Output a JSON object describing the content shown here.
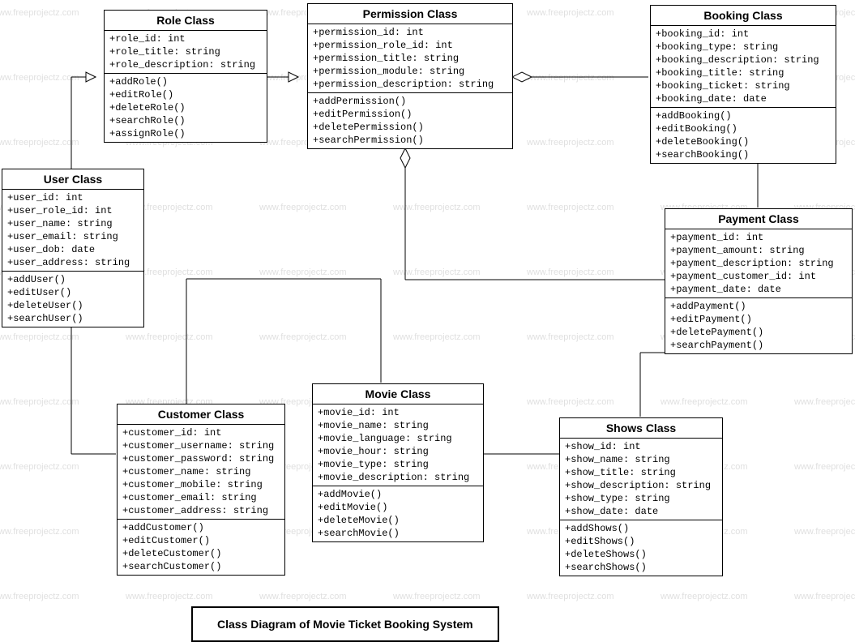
{
  "watermark_text": "www.freeprojectz.com",
  "caption": "Class Diagram of Movie Ticket Booking System",
  "classes": {
    "role": {
      "title": "Role Class",
      "attributes": [
        "+role_id: int",
        "+role_title: string",
        "+role_description: string"
      ],
      "operations": [
        "+addRole()",
        "+editRole()",
        "+deleteRole()",
        "+searchRole()",
        "+assignRole()"
      ]
    },
    "permission": {
      "title": "Permission Class",
      "attributes": [
        "+permission_id: int",
        "+permission_role_id: int",
        "+permission_title: string",
        "+permission_module: string",
        "+permission_description: string"
      ],
      "operations": [
        "+addPermission()",
        "+editPermission()",
        "+deletePermission()",
        "+searchPermission()"
      ]
    },
    "booking": {
      "title": "Booking Class",
      "attributes": [
        "+booking_id: int",
        "+booking_type: string",
        "+booking_description: string",
        "+booking_title: string",
        "+booking_ticket: string",
        "+booking_date: date"
      ],
      "operations": [
        "+addBooking()",
        "+editBooking()",
        "+deleteBooking()",
        "+searchBooking()"
      ]
    },
    "user": {
      "title": "User Class",
      "attributes": [
        "+user_id: int",
        "+user_role_id: int",
        "+user_name: string",
        "+user_email: string",
        "+user_dob: date",
        "+user_address: string"
      ],
      "operations": [
        "+addUser()",
        "+editUser()",
        "+deleteUser()",
        "+searchUser()"
      ]
    },
    "payment": {
      "title": "Payment Class",
      "attributes": [
        "+payment_id: int",
        "+payment_amount: string",
        "+payment_description: string",
        "+payment_customer_id: int",
        "+payment_date: date"
      ],
      "operations": [
        "+addPayment()",
        "+editPayment()",
        "+deletePayment()",
        "+searchPayment()"
      ]
    },
    "customer": {
      "title": "Customer Class",
      "attributes": [
        "+customer_id: int",
        "+customer_username: string",
        "+customer_password: string",
        "+customer_name: string",
        "+customer_mobile: string",
        "+customer_email: string",
        "+customer_address: string"
      ],
      "operations": [
        "+addCustomer()",
        "+editCustomer()",
        "+deleteCustomer()",
        "+searchCustomer()"
      ]
    },
    "movie": {
      "title": "Movie  Class",
      "attributes": [
        "+movie_id: int",
        "+movie_name: string",
        "+movie_language: string",
        "+movie_hour: string",
        "+movie_type: string",
        "+movie_description: string"
      ],
      "operations": [
        "+addMovie()",
        "+editMovie()",
        "+deleteMovie()",
        "+searchMovie()"
      ]
    },
    "shows": {
      "title": "Shows Class",
      "attributes": [
        "+show_id: int",
        "+show_name: string",
        "+show_title: string",
        "+show_description: string",
        "+show_type: string",
        "+show_date: date"
      ],
      "operations": [
        "+addShows()",
        "+editShows()",
        "+deleteShows()",
        "+searchShows()"
      ]
    }
  }
}
